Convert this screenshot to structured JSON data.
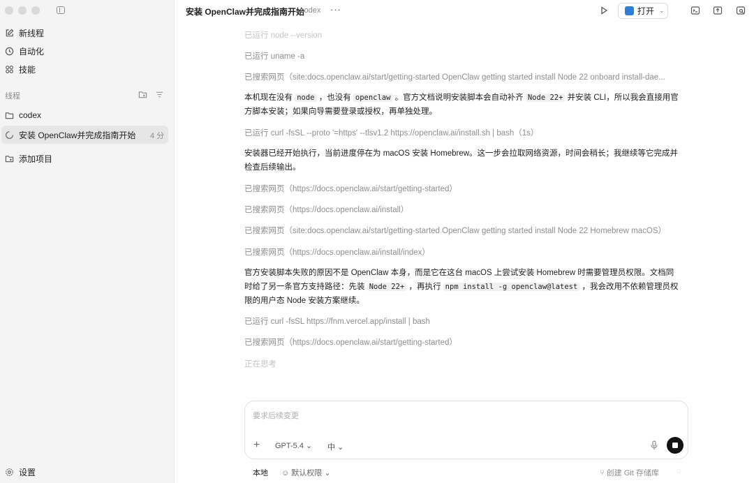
{
  "sidebar": {
    "nav": [
      {
        "label": "新线程",
        "icon": "edit-icon"
      },
      {
        "label": "自动化",
        "icon": "clock-icon"
      },
      {
        "label": "技能",
        "icon": "grid-icon"
      }
    ],
    "section_label": "线程",
    "project": "codex",
    "active_thread": {
      "title": "安装 OpenClaw并完成指南开始",
      "time": "4 分"
    },
    "add_project": "添加项目",
    "settings": "设置"
  },
  "topbar": {
    "title": "安装 OpenClaw并完成指南开始",
    "project": "codex",
    "more": "···",
    "open_label": "打开"
  },
  "feed": {
    "l1": "已运行 node --version",
    "l2": "已运行 uname -a",
    "l3": "已搜索网页（site:docs.openclaw.ai/start/getting-started OpenClaw getting started install Node 22 onboard install-dae...",
    "p1": {
      "a": "本机现在没有 ",
      "c1": "node",
      "b": " ，也没有 ",
      "c2": "openclaw",
      "c": " 。官方文档说明安装脚本会自动补齐 ",
      "c3": "Node 22+",
      "d": " 并安装 CLI，所以我会直接用官方脚本安装；如果向导需要登录或授权，再单独处理。"
    },
    "l4": "已运行 curl -fsSL --proto '=https' --tlsv1.2 https://openclaw.ai/install.sh | bash（1s）",
    "p2": "安装器已经开始执行，当前进度停在为 macOS 安装 Homebrew。这一步会拉取网络资源，时间会稍长；我继续等它完成并检查后续输出。",
    "l5": "已搜索网页（https://docs.openclaw.ai/start/getting-started）",
    "l6": "已搜索网页（https://docs.openclaw.ai/install）",
    "l7": "已搜索网页（site:docs.openclaw.ai/start/getting-started OpenClaw getting started install Node 22 Homebrew macOS）",
    "l8": "已搜索网页（https://docs.openclaw.ai/install/index）",
    "p3": {
      "a": "官方安装脚本失败的原因不是 OpenClaw 本身，而是它在这台 macOS 上尝试安装 Homebrew 时需要管理员权限。文档同时给了另一条官方支持路径：先装 ",
      "c1": "Node 22+",
      "b": " ，再执行 ",
      "c2": "npm install -g openclaw@latest",
      "c": " ，我会改用不依赖管理员权限的用户态 Node 安装方案继续。"
    },
    "l9": "已运行 curl -fsSL https://fnm.vercel.app/install | bash",
    "l10": "已搜索网页（https://docs.openclaw.ai/start/getting-started）",
    "thinking": "正在思考"
  },
  "composer": {
    "placeholder": "要求后续变更",
    "model": "GPT-5.4",
    "effort": "中"
  },
  "footer": {
    "local": "本地",
    "permissions": "默认权限",
    "git": "创建 Git 存储库"
  }
}
